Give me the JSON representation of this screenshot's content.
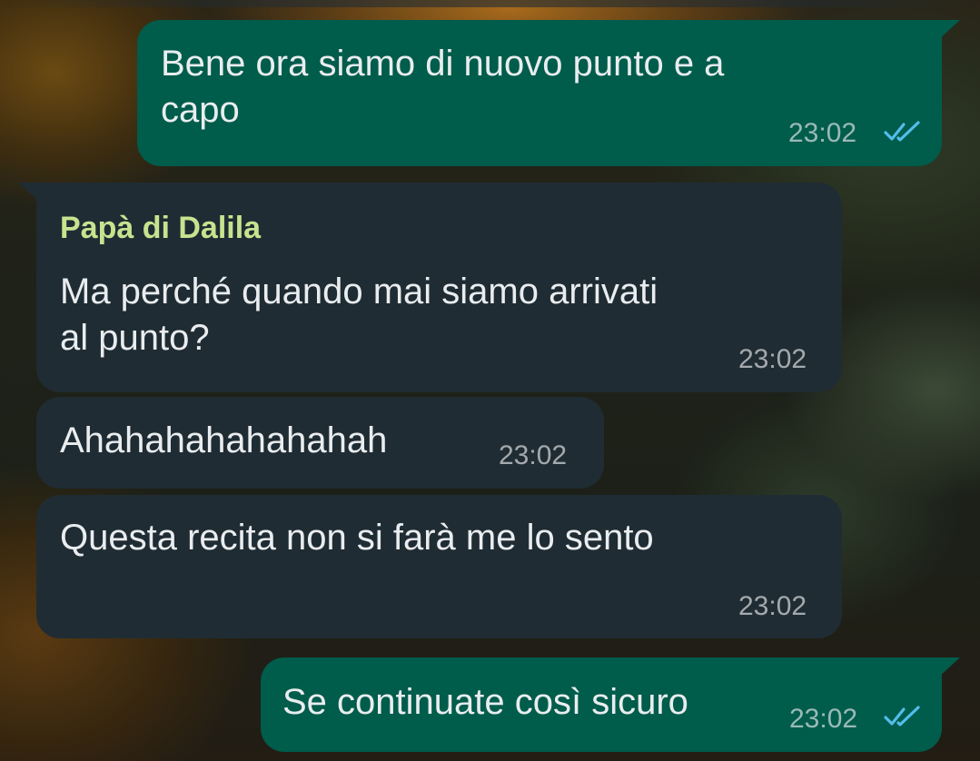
{
  "colors": {
    "outgoing_bubble": "#005c4b",
    "incoming_bubble": "#202c33",
    "sender_name": "#c8e38f",
    "read_ticks": "#53bdeb"
  },
  "messages": [
    {
      "direction": "outgoing",
      "text": "Bene ora siamo di nuovo punto e a\ncapo",
      "time": "23:02",
      "status": "read-double-tick-icon"
    },
    {
      "direction": "incoming",
      "sender": "Papà di Dalila",
      "text": "Ma perché quando mai siamo arrivati\nal punto?",
      "time": "23:02"
    },
    {
      "direction": "incoming",
      "text": "Ahahahahahahahah",
      "time": "23:02"
    },
    {
      "direction": "incoming",
      "text": "Questa recita non si farà me lo sento",
      "time": "23:02"
    },
    {
      "direction": "outgoing",
      "text": "Se continuate così sicuro",
      "time": "23:02",
      "status": "read-double-tick-icon"
    }
  ]
}
